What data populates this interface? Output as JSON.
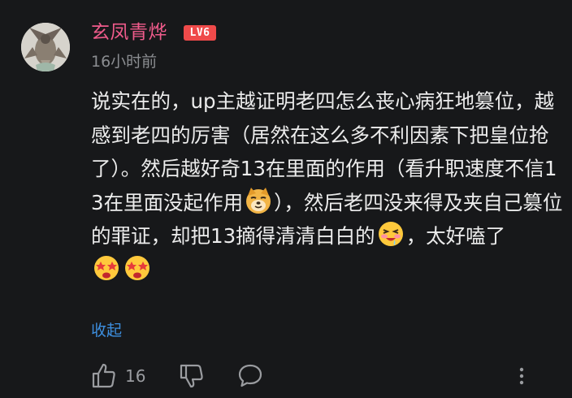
{
  "comment": {
    "username": "玄凤青烨",
    "level_badge": "LV6",
    "timestamp": "16小时前",
    "body": {
      "part1": "说实在的，up主越证明老四怎么丧心病狂地篡位，越感到老四的厉害（居然在这么多不利因素下把皇位抢了）。然后越好奇13在里面的作用（看升职速度不信13在里面没起作用",
      "emoji1": "doge-emoji",
      "part2": "），然后老四没来得及夹自己篡位的罪证，却把13摘得清清白白的",
      "emoji2": "drooling-emoji",
      "part3": "，太好嗑了",
      "emoji3": "heart-eyes-emoji",
      "emoji4": "heart-eyes-emoji"
    },
    "collapse_label": "收起",
    "actions": {
      "like_icon": "thumbs-up-icon",
      "like_count": "16",
      "dislike_icon": "thumbs-down-icon",
      "reply_icon": "reply-bubble-icon",
      "more_icon": "more-vertical-icon"
    }
  },
  "colors": {
    "background": "#17181a",
    "username": "#ef5b8b",
    "level_badge": "#ef4a4a",
    "text": "#ececec",
    "meta": "#8b8d91",
    "link": "#3d8fe0"
  }
}
